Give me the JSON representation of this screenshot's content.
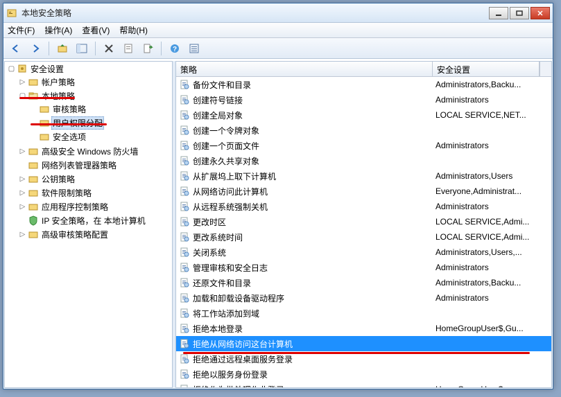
{
  "window": {
    "title": "本地安全策略"
  },
  "menu": {
    "file": "文件(F)",
    "action": "操作(A)",
    "view": "查看(V)",
    "help": "帮助(H)"
  },
  "tree": {
    "root": "安全设置",
    "n_account": "帐户策略",
    "n_local": "本地策略",
    "n_audit": "审核策略",
    "n_userrights": "用户权限分配",
    "n_secoptions": "安全选项",
    "n_winfw": "高级安全 Windows 防火墙",
    "n_netlist": "网络列表管理器策略",
    "n_pubkey": "公钥策略",
    "n_swrestrict": "软件限制策略",
    "n_appctrl": "应用程序控制策略",
    "n_ipsec": "IP 安全策略，在 本地计算机",
    "n_advaudit": "高级审核策略配置"
  },
  "list": {
    "col_policy": "策略",
    "col_secset": "安全设置",
    "rows": [
      {
        "p": "备份文件和目录",
        "s": "Administrators,Backu..."
      },
      {
        "p": "创建符号链接",
        "s": "Administrators"
      },
      {
        "p": "创建全局对象",
        "s": "LOCAL SERVICE,NET..."
      },
      {
        "p": "创建一个令牌对象",
        "s": ""
      },
      {
        "p": "创建一个页面文件",
        "s": "Administrators"
      },
      {
        "p": "创建永久共享对象",
        "s": ""
      },
      {
        "p": "从扩展坞上取下计算机",
        "s": "Administrators,Users"
      },
      {
        "p": "从网络访问此计算机",
        "s": "Everyone,Administrat..."
      },
      {
        "p": "从远程系统强制关机",
        "s": "Administrators"
      },
      {
        "p": "更改时区",
        "s": "LOCAL SERVICE,Admi..."
      },
      {
        "p": "更改系统时间",
        "s": "LOCAL SERVICE,Admi..."
      },
      {
        "p": "关闭系统",
        "s": "Administrators,Users,..."
      },
      {
        "p": "管理审核和安全日志",
        "s": "Administrators"
      },
      {
        "p": "还原文件和目录",
        "s": "Administrators,Backu..."
      },
      {
        "p": "加载和卸载设备驱动程序",
        "s": "Administrators"
      },
      {
        "p": "将工作站添加到域",
        "s": ""
      },
      {
        "p": "拒绝本地登录",
        "s": "HomeGroupUser$,Gu..."
      },
      {
        "p": "拒绝从网络访问这台计算机",
        "s": "",
        "sel": true
      },
      {
        "p": "拒绝通过远程桌面服务登录",
        "s": ""
      },
      {
        "p": "拒绝以服务身份登录",
        "s": ""
      },
      {
        "p": "拒绝作为批处理作业登录",
        "s": "HomeGroupUser$"
      }
    ]
  }
}
